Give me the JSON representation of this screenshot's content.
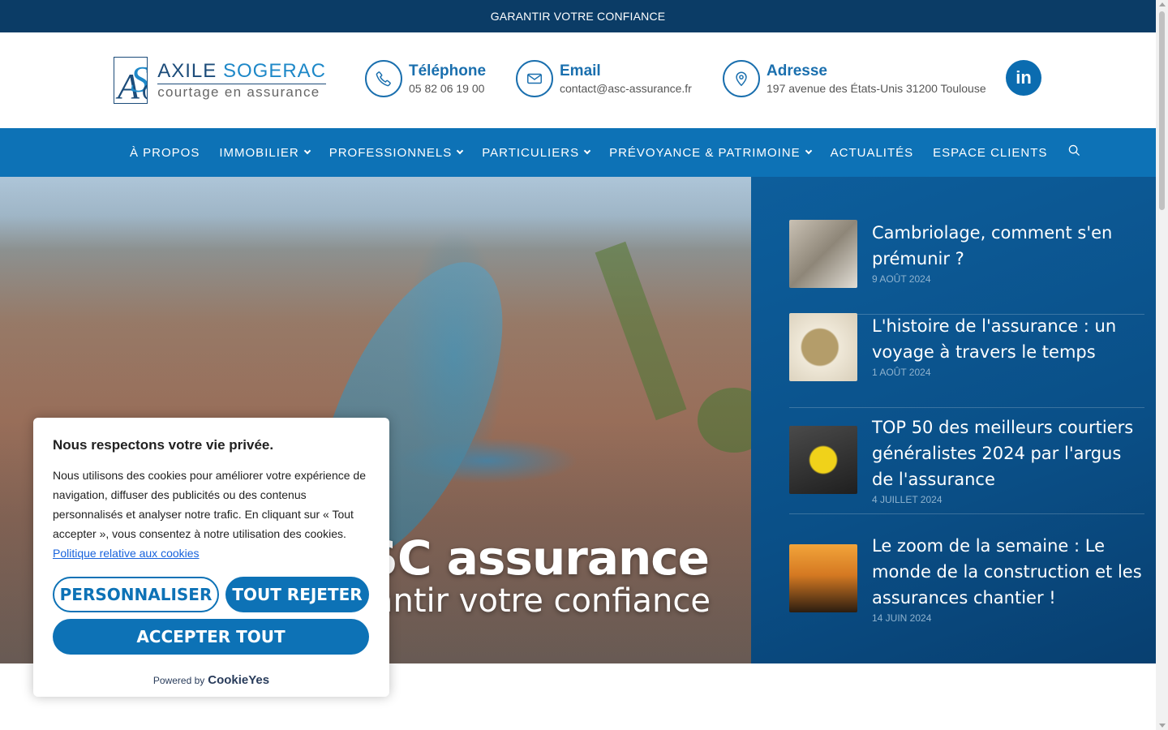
{
  "topbar": {
    "text": "GARANTIR VOTRE CONFIANCE"
  },
  "logo": {
    "title_part1": "AXILE ",
    "title_part2": "SOGERAC",
    "subtitle": "courtage en assurance",
    "mark_a": "A",
    "mark_s": "S",
    "mark_c": "C"
  },
  "contacts": {
    "phone": {
      "label": "Téléphone",
      "value": "05 82 06 19 00",
      "icon": "phone-icon"
    },
    "email": {
      "label": "Email",
      "value": "contact@asc-assurance.fr",
      "icon": "mail-icon"
    },
    "address": {
      "label": "Adresse",
      "value": "197 avenue des États-Unis 31200 Toulouse",
      "icon": "location-pin-icon"
    }
  },
  "social": {
    "linkedin": "in"
  },
  "nav": {
    "items": [
      {
        "label": "À PROPOS",
        "dropdown": false
      },
      {
        "label": "IMMOBILIER",
        "dropdown": true
      },
      {
        "label": "PROFESSIONNELS",
        "dropdown": true
      },
      {
        "label": "PARTICULIERS",
        "dropdown": true
      },
      {
        "label": "PRÉVOYANCE & PATRIMOINE",
        "dropdown": true
      },
      {
        "label": "ACTUALITÉS",
        "dropdown": false
      },
      {
        "label": "ESPACE CLIENTS",
        "dropdown": false
      }
    ]
  },
  "hero": {
    "title": "ASC assurance",
    "subtitle": "rantir votre confiance"
  },
  "news": [
    {
      "title": "Cambriolage, comment s'en prémunir ?",
      "date": "9 AOÛT 2024"
    },
    {
      "title": "L'histoire de l'assurance : un voyage à travers le temps",
      "date": "1 AOÛT 2024"
    },
    {
      "title": "TOP 50 des meilleurs courtiers généralistes 2024 par l'argus de l'assurance",
      "date": "4 JUILLET 2024"
    },
    {
      "title": "Le zoom de la semaine : Le monde de la construction et les assurances chantier !",
      "date": "14 JUIN 2024"
    }
  ],
  "cookie": {
    "heading": "Nous respectons votre vie privée.",
    "text": "Nous utilisons des cookies pour améliorer votre expérience de navigation, diffuser des publicités ou des contenus personnalisés et analyser notre trafic. En cliquant sur « Tout accepter », vous consentez à notre utilisation des cookies.",
    "policy_link": "Politique relative aux cookies",
    "btn_customize": "PERSONNALISER",
    "btn_reject": "TOUT REJETER",
    "btn_accept": "ACCEPTER TOUT",
    "powered_by": "Powered by",
    "brand": "CookieYes"
  },
  "colors": {
    "topbar": "#0b3c66",
    "nav": "#0d72b6",
    "accent": "#1a6fae",
    "news_panel": "#0a4f87"
  }
}
